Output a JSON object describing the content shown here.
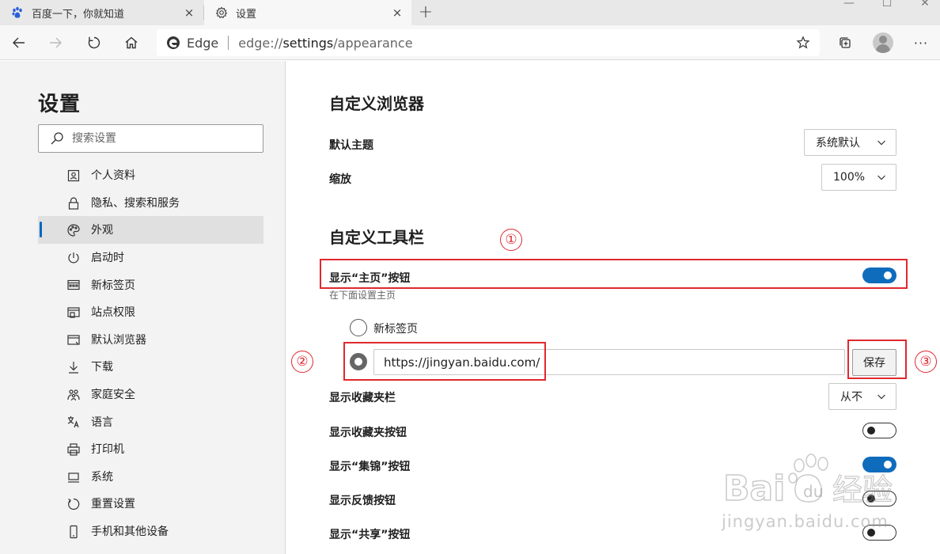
{
  "tabs": [
    {
      "title": "百度一下，你就知道",
      "close": "×"
    },
    {
      "title": "设置",
      "close": "×"
    }
  ],
  "new_tab": "+",
  "window_controls": {
    "minimize": "—",
    "maximize": "☐",
    "close": "✕"
  },
  "toolbar": {
    "address_brand": "Edge",
    "address_scheme": "edge://",
    "address_path": "settings",
    "address_rest": "/appearance",
    "more": "···"
  },
  "sidebar": {
    "title": "设置",
    "search_placeholder": "搜索设置",
    "items": [
      {
        "label": "个人资料",
        "icon": "profile-icon"
      },
      {
        "label": "隐私、搜索和服务",
        "icon": "lock-icon"
      },
      {
        "label": "外观",
        "icon": "palette-icon",
        "active": true
      },
      {
        "label": "启动时",
        "icon": "power-icon"
      },
      {
        "label": "新标签页",
        "icon": "newtab-icon"
      },
      {
        "label": "站点权限",
        "icon": "site-permissions-icon"
      },
      {
        "label": "默认浏览器",
        "icon": "default-browser-icon"
      },
      {
        "label": "下载",
        "icon": "download-icon"
      },
      {
        "label": "家庭安全",
        "icon": "family-icon"
      },
      {
        "label": "语言",
        "icon": "language-icon"
      },
      {
        "label": "打印机",
        "icon": "printer-icon"
      },
      {
        "label": "系统",
        "icon": "system-icon"
      },
      {
        "label": "重置设置",
        "icon": "reset-icon"
      },
      {
        "label": "手机和其他设备",
        "icon": "phone-icon"
      }
    ]
  },
  "main": {
    "customize_browser": {
      "title": "自定义浏览器",
      "default_theme_label": "默认主题",
      "default_theme_value": "系统默认",
      "zoom_label": "缩放",
      "zoom_value": "100%"
    },
    "customize_toolbar": {
      "title": "自定义工具栏",
      "show_home_label": "显示“主页”按钮",
      "show_home_on": true,
      "show_home_sub": "在下面设置主页",
      "radio_newtab_label": "新标签页",
      "home_url": "https://jingyan.baidu.com/",
      "save_label": "保存",
      "favorites_bar_label": "显示收藏夹栏",
      "favorites_bar_value": "从不",
      "favorites_button_label": "显示收藏夹按钮",
      "favorites_button_on": false,
      "collections_label": "显示“集锦”按钮",
      "collections_on": true,
      "feedback_label": "显示反馈按钮",
      "feedback_on": false,
      "share_label": "显示“共享”按钮",
      "share_on": false
    }
  },
  "annotations": [
    "①",
    "②",
    "③"
  ],
  "watermark": {
    "brand_left": "Bai",
    "brand_right": "经验",
    "url": "jingyan.baidu.com"
  },
  "colors": {
    "accent": "#0f6cbd",
    "annotation": "#e0282e",
    "active_indicator": "#0067c0"
  }
}
